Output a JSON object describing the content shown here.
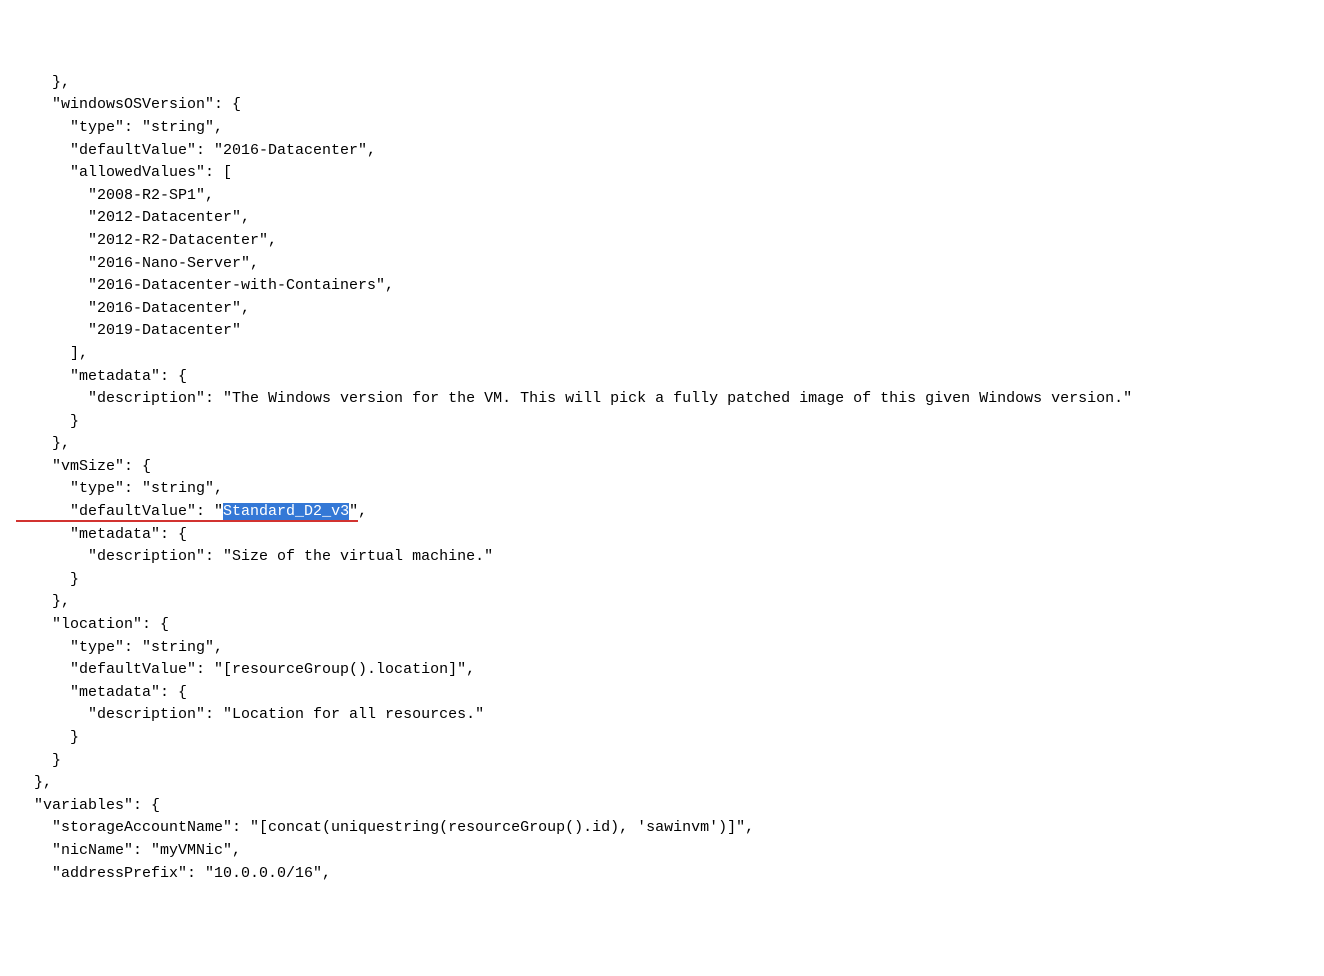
{
  "lines": {
    "l01": "    },",
    "l02": "    \"windowsOSVersion\": {",
    "l03": "      \"type\": \"string\",",
    "l04": "      \"defaultValue\": \"2016-Datacenter\",",
    "l05": "      \"allowedValues\": [",
    "l06": "        \"2008-R2-SP1\",",
    "l07": "        \"2012-Datacenter\",",
    "l08": "        \"2012-R2-Datacenter\",",
    "l09": "        \"2016-Nano-Server\",",
    "l10": "        \"2016-Datacenter-with-Containers\",",
    "l11": "        \"2016-Datacenter\",",
    "l12": "        \"2019-Datacenter\"",
    "l13": "      ],",
    "l14": "      \"metadata\": {",
    "l15": "        \"description\": \"The Windows version for the VM. This will pick a fully patched image of this given Windows version.\"",
    "l16": "      }",
    "l17": "    },",
    "l18": "    \"vmSize\": {",
    "l19": "      \"type\": \"string\",",
    "l20a": "      \"defaultValue\": \"",
    "l20b": "Standard_D2_v3",
    "l20c": "\",",
    "l21": "      \"metadata\": {",
    "l22": "        \"description\": \"Size of the virtual machine.\"",
    "l23": "      }",
    "l24": "    },",
    "l25": "    \"location\": {",
    "l26": "      \"type\": \"string\",",
    "l27": "      \"defaultValue\": \"[resourceGroup().location]\",",
    "l28": "      \"metadata\": {",
    "l29": "        \"description\": \"Location for all resources.\"",
    "l30": "      }",
    "l31": "    }",
    "l32": "  },",
    "l33": "  \"variables\": {",
    "l34": "    \"storageAccountName\": \"[concat(uniquestring(resourceGroup().id), 'sawinvm')]\",",
    "l35": "    \"nicName\": \"myVMNic\",",
    "l36": "    \"addressPrefix\": \"10.0.0.0/16\","
  }
}
